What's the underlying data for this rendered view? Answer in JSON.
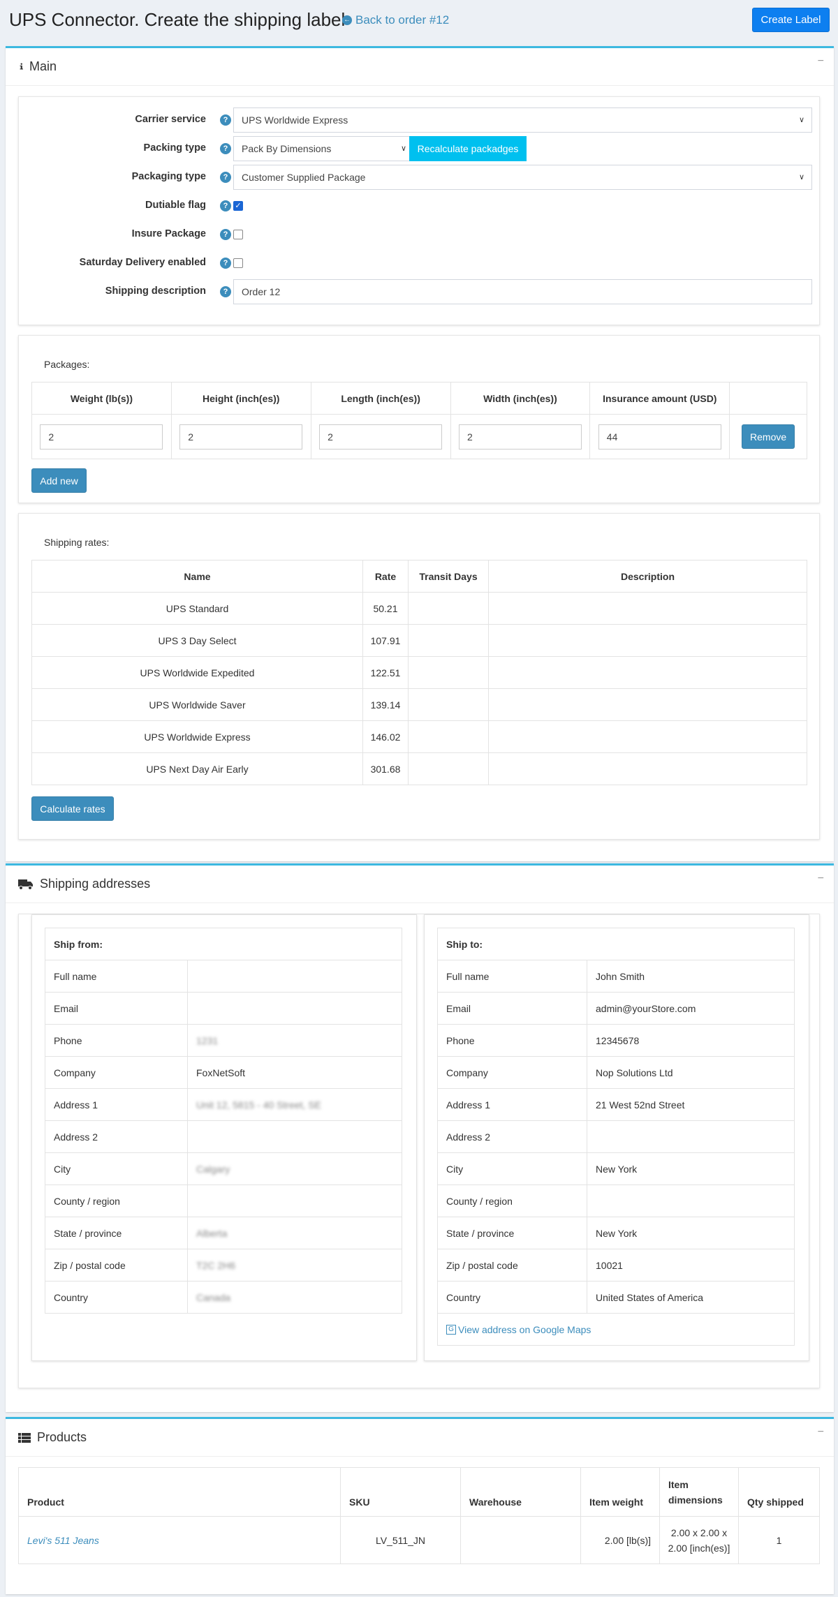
{
  "header": {
    "title": "UPS Connector. Create the shipping label",
    "back_link": "Back to order #12",
    "create_button": "Create Label"
  },
  "main": {
    "title": "Main",
    "fields": {
      "carrier_service": {
        "label": "Carrier service",
        "value": "UPS Worldwide Express"
      },
      "packing_type": {
        "label": "Packing type",
        "value": "Pack By Dimensions",
        "button": "Recalculate packadges"
      },
      "packaging_type": {
        "label": "Packaging type",
        "value": "Customer Supplied Package"
      },
      "dutiable": {
        "label": "Dutiable flag",
        "checked": true
      },
      "insure": {
        "label": "Insure Package",
        "checked": false
      },
      "saturday": {
        "label": "Saturday Delivery enabled",
        "checked": false
      },
      "description": {
        "label": "Shipping description",
        "value": "Order 12"
      }
    },
    "help_glyph": "?",
    "check_glyph": "✓",
    "packages": {
      "label": "Packages:",
      "headers": [
        "Weight (lb(s))",
        "Height (inch(es))",
        "Length (inch(es))",
        "Width (inch(es))",
        "Insurance amount (USD)"
      ],
      "row": [
        "2",
        "2",
        "2",
        "2",
        "44"
      ],
      "remove_button": "Remove",
      "add_button": "Add new"
    },
    "rates": {
      "label": "Shipping rates:",
      "headers": [
        "Name",
        "Rate",
        "Transit Days",
        "Description"
      ],
      "rows": [
        [
          "UPS Standard",
          "50.21"
        ],
        [
          "UPS 3 Day Select",
          "107.91"
        ],
        [
          "UPS Worldwide Expedited",
          "122.51"
        ],
        [
          "UPS Worldwide Saver",
          "139.14"
        ],
        [
          "UPS Worldwide Express",
          "146.02"
        ],
        [
          "UPS Next Day Air Early",
          "301.68"
        ]
      ],
      "calc_button": "Calculate rates"
    }
  },
  "addresses": {
    "title": "Shipping addresses",
    "from": {
      "heading": "Ship from:",
      "rows": [
        [
          "Full name",
          ""
        ],
        [
          "Email",
          ""
        ],
        [
          "Phone",
          "1231"
        ],
        [
          "Company",
          "FoxNetSoft"
        ],
        [
          "Address 1",
          "Unit 12, 5815 - 40 Street, SE"
        ],
        [
          "Address 2",
          ""
        ],
        [
          "City",
          "Calgary"
        ],
        [
          "County / region",
          ""
        ],
        [
          "State / province",
          "Alberta"
        ],
        [
          "Zip / postal code",
          "T2C 2H6"
        ],
        [
          "Country",
          "Canada"
        ]
      ]
    },
    "to": {
      "heading": "Ship to:",
      "rows": [
        [
          "Full name",
          "John Smith"
        ],
        [
          "Email",
          "admin@yourStore.com"
        ],
        [
          "Phone",
          "12345678"
        ],
        [
          "Company",
          "Nop Solutions Ltd"
        ],
        [
          "Address 1",
          "21 West 52nd Street"
        ],
        [
          "Address 2",
          ""
        ],
        [
          "City",
          "New York"
        ],
        [
          "County / region",
          ""
        ],
        [
          "State / province",
          "New York"
        ],
        [
          "Zip / postal code",
          "10021"
        ],
        [
          "Country",
          "United States of America"
        ]
      ],
      "map_link": "View address on Google Maps"
    }
  },
  "products": {
    "title": "Products",
    "headers": [
      "Product",
      "SKU",
      "Warehouse",
      "Item weight",
      "Item dimensions",
      "Qty shipped"
    ],
    "rows": [
      [
        "Levi's 511 Jeans",
        "LV_511_JN",
        "",
        "2.00 [lb(s)]",
        "2.00 x 2.00 x 2.00 [inch(es)]",
        "1"
      ]
    ]
  },
  "icons": {
    "collapse": "−",
    "back": "←",
    "map": "G"
  }
}
